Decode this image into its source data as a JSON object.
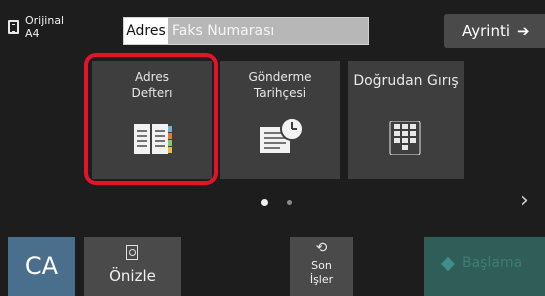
{
  "original": {
    "label": "Orijinal",
    "size": "A4"
  },
  "address": {
    "chip": "Adres",
    "placeholder": "Faks Numarası"
  },
  "detail": {
    "label": "Ayrinti",
    "arrow": "➔"
  },
  "tiles": [
    {
      "label": "Adres\nDefterı",
      "icon": "address-book-icon"
    },
    {
      "label": "Gönderme\nTarihçesi",
      "icon": "send-history-icon"
    },
    {
      "label": "Doğrudan Gırış",
      "icon": "keypad-icon"
    }
  ],
  "pager": {
    "pages": 2,
    "current": 1,
    "next": "›"
  },
  "bottom": {
    "ca": "CA",
    "preview": "Önizle",
    "recent_icon": "⟲",
    "recent": "Son\nİşler",
    "start": "Başlama"
  },
  "colors": {
    "selection": "#e4132b",
    "ca": "#4a6f8c",
    "start": "#2f5e58"
  }
}
